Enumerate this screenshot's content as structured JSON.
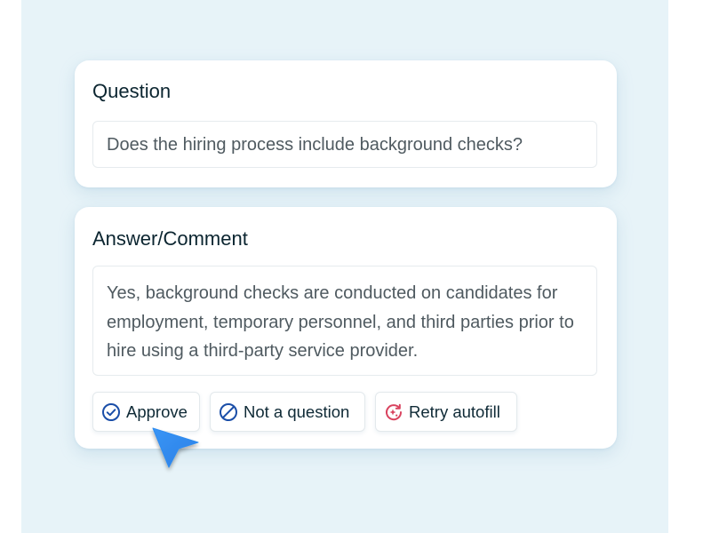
{
  "question": {
    "title": "Question",
    "value": "Does the hiring process include background checks?"
  },
  "answer": {
    "title": "Answer/Comment",
    "value": "Yes, background checks are conducted on candidates for employment, temporary personnel, and third parties prior to hire using a third-party service provider."
  },
  "actions": {
    "approve": {
      "label": "Approve",
      "icon": "check-circle-icon"
    },
    "not_question": {
      "label": "Not a question",
      "icon": "ban-icon"
    },
    "retry": {
      "label": "Retry autofill",
      "icon": "sparkle-retry-icon"
    }
  },
  "colors": {
    "background_panel": "#e7f3f8",
    "primary_icon": "#1a4ea8",
    "retry_icon": "#d9435f",
    "cursor": "#2f8cf0"
  }
}
